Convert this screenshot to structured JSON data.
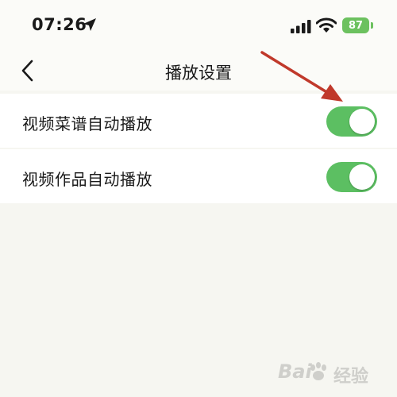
{
  "status_bar": {
    "time": "07:26",
    "battery": "87",
    "icons": [
      "location-arrow-icon",
      "signal-icon",
      "wifi-icon",
      "battery-icon"
    ]
  },
  "nav": {
    "title": "播放设置",
    "back_icon": "chevron-left-icon"
  },
  "settings": {
    "items": [
      {
        "label": "视频菜谱自动播放",
        "enabled": true
      },
      {
        "label": "视频作品自动播放",
        "enabled": true
      }
    ]
  },
  "annotation": {
    "arrow_color": "#c0392b"
  },
  "watermark": {
    "text": "Bai",
    "sub": "经验"
  },
  "colors": {
    "accent": "#5cbf62",
    "background": "#f6f6f1",
    "battery": "#6cc15f"
  }
}
